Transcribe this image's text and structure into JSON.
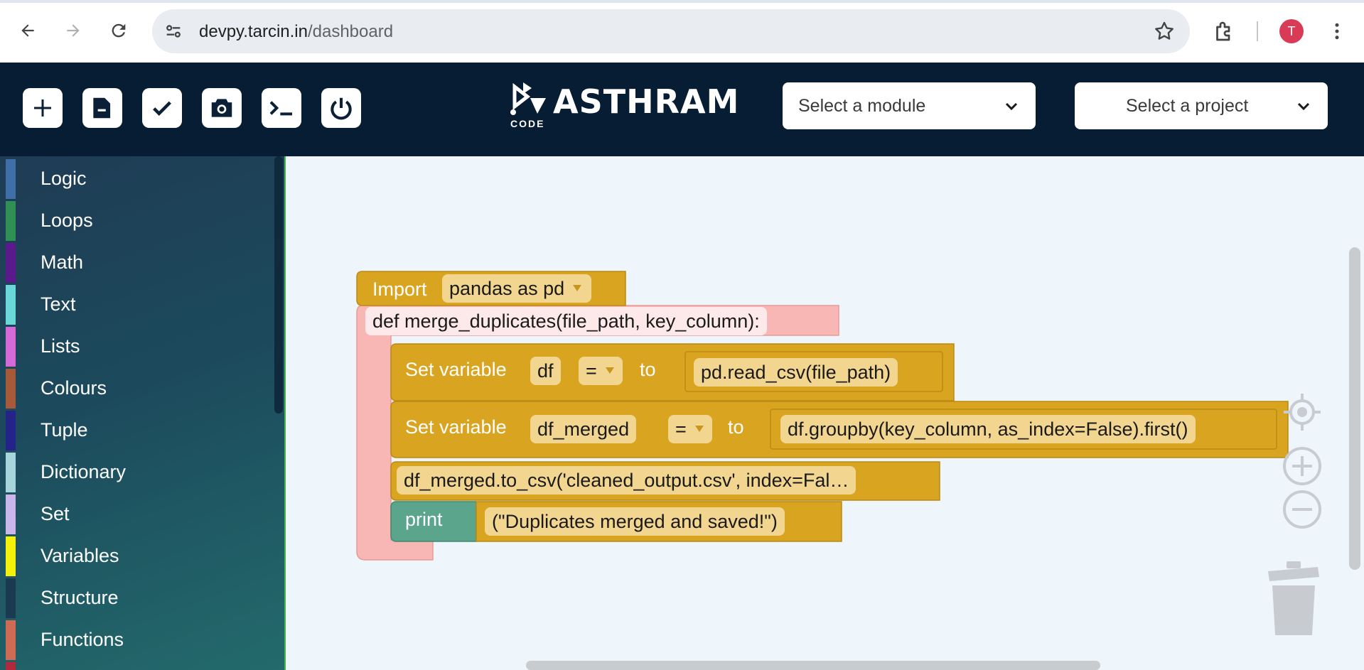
{
  "browser": {
    "url_host": "devpy.tarcin.in",
    "url_path": "/dashboard",
    "avatar_letter": "T",
    "icons": [
      "back-arrow-icon",
      "forward-arrow-icon",
      "reload-icon",
      "site-settings-icon",
      "bookmark-star-icon",
      "extensions-icon",
      "more-menu-icon"
    ]
  },
  "header": {
    "logo_text": "ASTHRAM",
    "logo_sub": "CODE",
    "tools": [
      "new-file-icon",
      "open-file-icon",
      "save-check-icon",
      "snapshot-icon",
      "terminal-icon",
      "power-icon"
    ],
    "module_select": "Select a module",
    "project_select": "Select a project"
  },
  "toolbox": {
    "items": [
      {
        "label": "Logic",
        "color": "#3e6fa6"
      },
      {
        "label": "Loops",
        "color": "#2f8f55"
      },
      {
        "label": "Math",
        "color": "#5a1a8c"
      },
      {
        "label": "Text",
        "color": "#6ad8d8"
      },
      {
        "label": "Lists",
        "color": "#d36ad6"
      },
      {
        "label": "Colours",
        "color": "#a65a3a"
      },
      {
        "label": "Tuple",
        "color": "#23238a"
      },
      {
        "label": "Dictionary",
        "color": "#a8d4dc"
      },
      {
        "label": "Set",
        "color": "#c9b7ea"
      },
      {
        "label": "Variables",
        "color": "#f4f20a"
      },
      {
        "label": "Structure",
        "color": "#1a3a52"
      },
      {
        "label": "Functions",
        "color": "#cf6b54"
      }
    ]
  },
  "blocks": {
    "import_label": "Import",
    "import_value": "pandas as pd",
    "def_text": "def merge_duplicates(file_path, key_column):",
    "set1_label": "Set variable",
    "set1_var": "df",
    "set1_op": "=",
    "set1_to": "to",
    "set1_value": "pd.read_csv(file_path)",
    "set2_label": "Set variable",
    "set2_var": "df_merged",
    "set2_op": "=",
    "set2_to": "to",
    "set2_value": "df.groupby(key_column, as_index=False).first()",
    "statement": "df_merged.to_csv('cleaned_output.csv', index=Fal…",
    "print_label": "print",
    "print_value": "(\"Duplicates merged and saved!\")",
    "colors": {
      "gold": "#d9a521",
      "pink": "#f8b7b5",
      "green": "#5ba58c",
      "pill": "#f2d58e"
    }
  }
}
